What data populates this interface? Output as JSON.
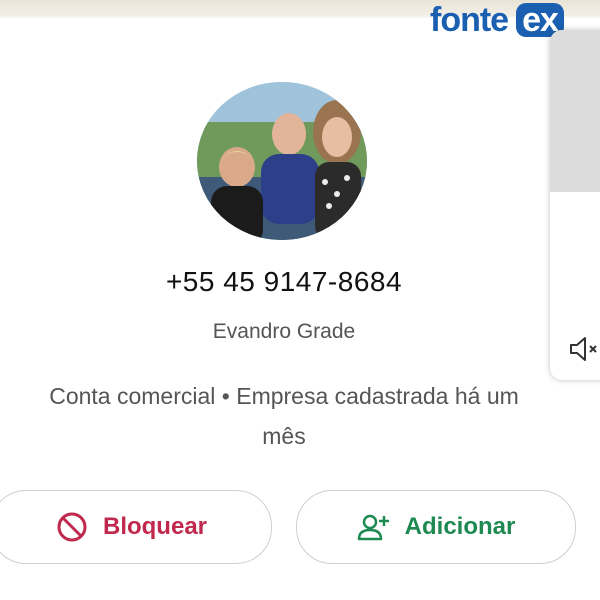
{
  "logo": {
    "text_main": "fonte",
    "text_badge": "ex"
  },
  "contact": {
    "phone": "+55 45 9147-8684",
    "name": "Evandro Grade",
    "description_line1": "Conta comercial • Empresa cadastrada há um",
    "description_line2": "mês"
  },
  "actions": {
    "block_label": "Bloquear",
    "add_label": "Adicionar"
  },
  "colors": {
    "block": "#c0284e",
    "add": "#1e8a52",
    "logo": "#1a5fb0"
  },
  "icons": {
    "block": "block-icon",
    "add": "add-person-icon",
    "speaker": "speaker-icon"
  }
}
